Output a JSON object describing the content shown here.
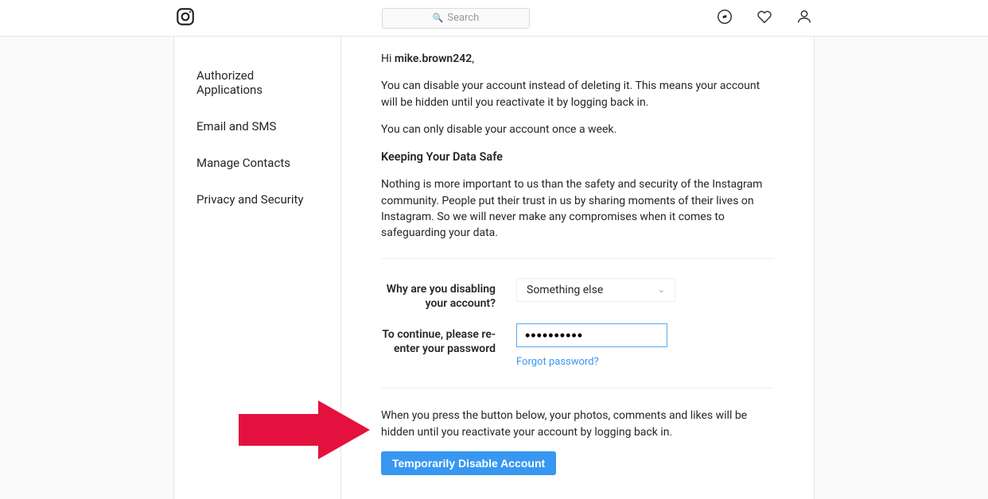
{
  "header": {
    "search_placeholder": "Search"
  },
  "sidebar": {
    "items": [
      {
        "label": "Authorized Applications"
      },
      {
        "label": "Email and SMS"
      },
      {
        "label": "Manage Contacts"
      },
      {
        "label": "Privacy and Security"
      }
    ]
  },
  "content": {
    "greeting_prefix": "Hi ",
    "username": "mike.brown242",
    "greeting_suffix": ",",
    "para1": "You can disable your account instead of deleting it. This means your account will be hidden until you reactivate it by logging back in.",
    "para2": "You can only disable your account once a week.",
    "section_heading": "Keeping Your Data Safe",
    "para3": "Nothing is more important to us than the safety and security of the Instagram community. People put their trust in us by sharing moments of their lives on Instagram. So we will never make any compromises when it comes to safeguarding your data.",
    "reason_label": "Why are you disabling your account?",
    "reason_selected": "Something else",
    "password_label": "To continue, please re-enter your password",
    "password_value": "••••••••••",
    "forgot_password": "Forgot password?",
    "final_warning": "When you press the button below, your photos, comments and likes will be hidden until you reactivate your account by logging back in.",
    "disable_button": "Temporarily Disable Account"
  }
}
